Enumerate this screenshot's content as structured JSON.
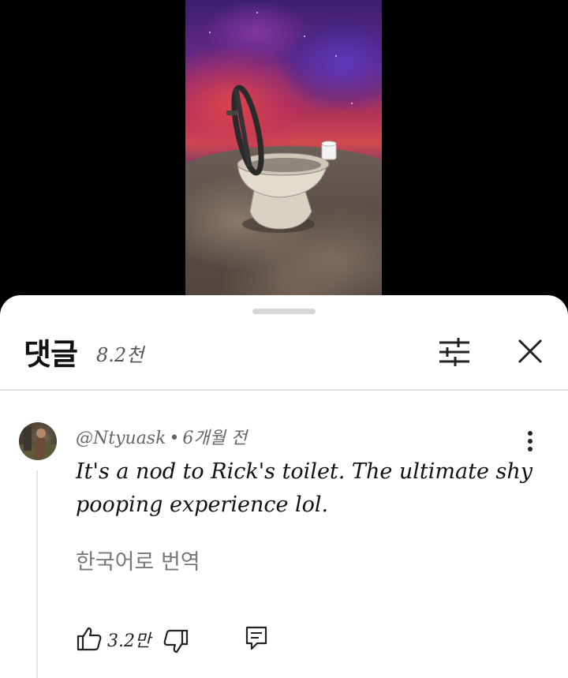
{
  "video": {
    "icon": "video-thumbnail"
  },
  "comments_panel": {
    "title": "댓글",
    "count": "8.2천",
    "filter_icon": "sliders-icon",
    "close_icon": "close-icon"
  },
  "comment": {
    "author": "@Ntyuask",
    "separator": "•",
    "timestamp": "6개월 전",
    "text": "It's a nod to Rick's toilet. The ultimate shy pooping experience lol.",
    "translate_label": "한국어로 번역",
    "like_count": "3.2만"
  }
}
